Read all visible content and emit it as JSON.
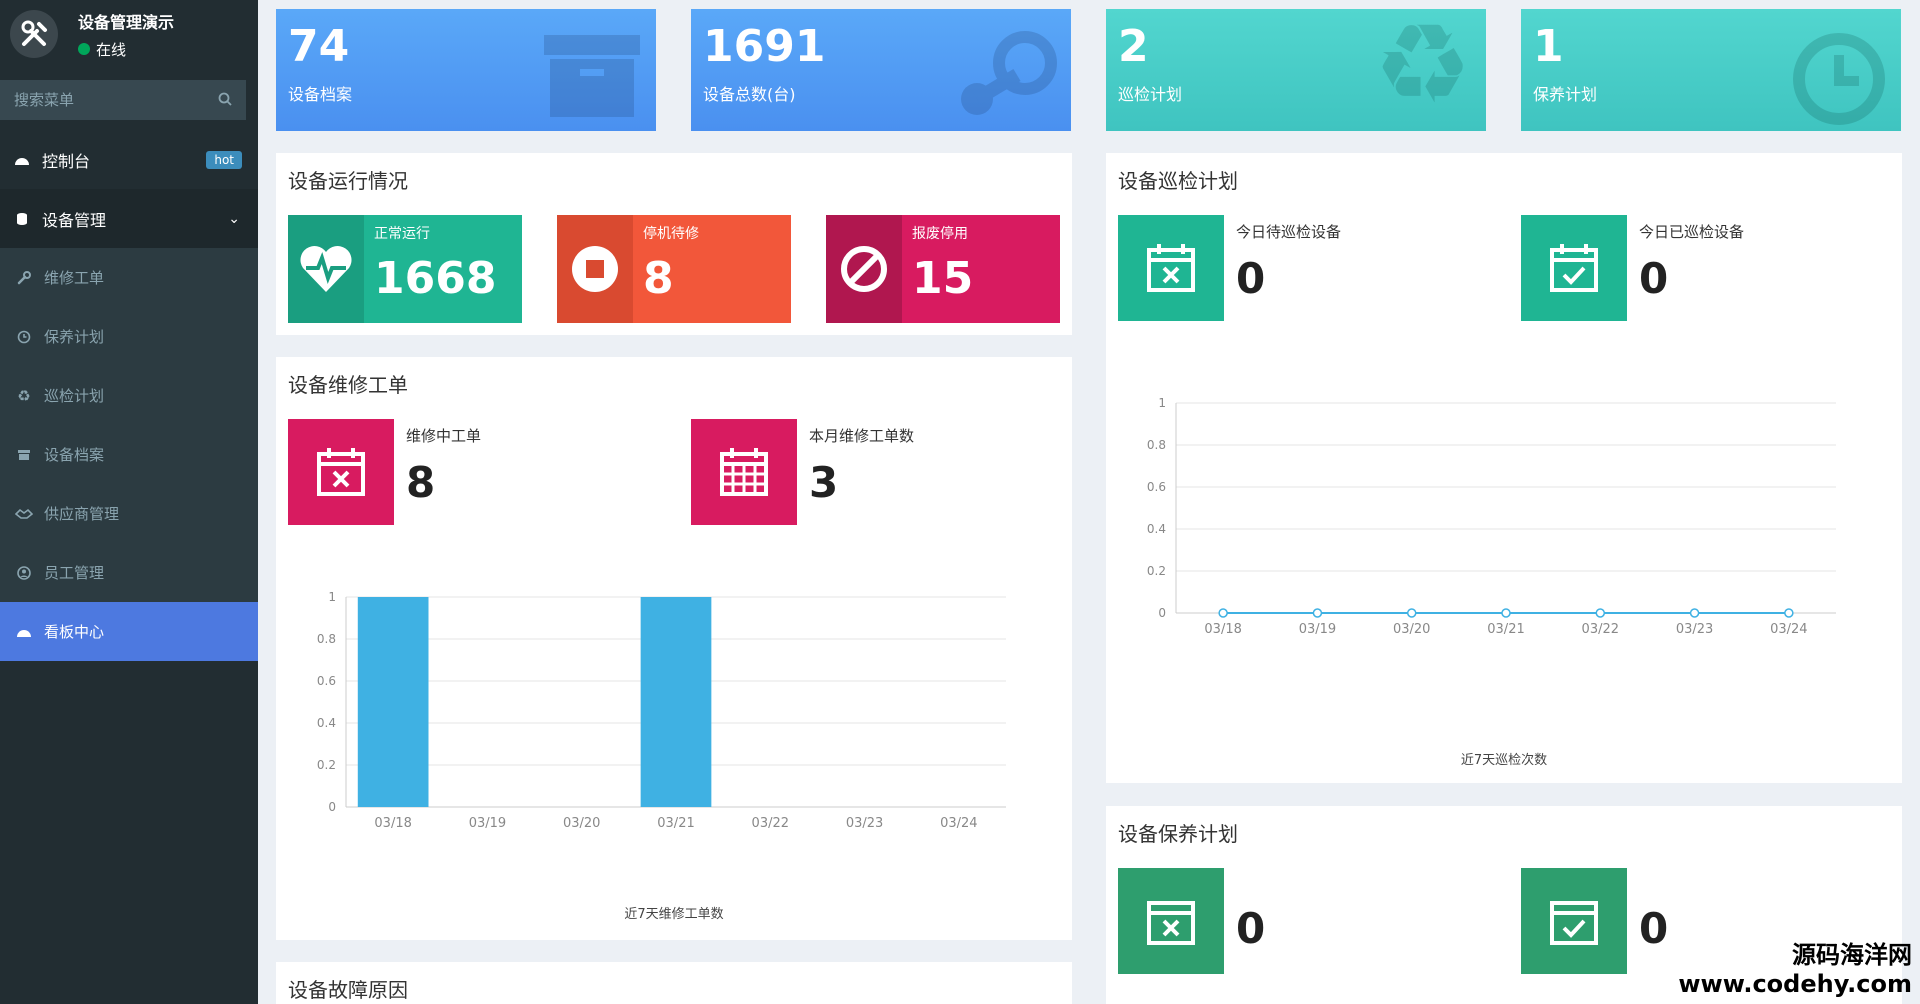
{
  "sidebar": {
    "brand_title": "设备管理演示",
    "status": "在线",
    "search_placeholder": "搜索菜单",
    "items": [
      {
        "label": "控制台",
        "badge": "hot"
      },
      {
        "label": "设备管理"
      },
      {
        "label": "维修工单"
      },
      {
        "label": "保养计划"
      },
      {
        "label": "巡检计划"
      },
      {
        "label": "设备档案"
      },
      {
        "label": "供应商管理"
      },
      {
        "label": "员工管理"
      },
      {
        "label": "看板中心"
      }
    ]
  },
  "stats": [
    {
      "value": "74",
      "label": "设备档案",
      "icon": "archive-icon"
    },
    {
      "value": "1691",
      "label": "设备总数(台)",
      "icon": "steam-icon"
    },
    {
      "value": "2",
      "label": "巡检计划",
      "icon": "recycle-icon"
    },
    {
      "value": "1",
      "label": "保养计划",
      "icon": "clock-icon"
    }
  ],
  "running": {
    "title": "设备运行情况",
    "tiles": [
      {
        "label": "正常运行",
        "value": "1668",
        "color": "#1fb593",
        "dark": "#1a9e80"
      },
      {
        "label": "停机待修",
        "value": "8",
        "color": "#f2573a",
        "dark": "#d94a30"
      },
      {
        "label": "报废停用",
        "value": "15",
        "color": "#d81b60",
        "dark": "#b0174f"
      }
    ]
  },
  "repair": {
    "title": "设备维修工单",
    "in_progress_label": "维修中工单",
    "in_progress_value": "8",
    "month_label": "本月维修工单数",
    "month_value": "3",
    "caption": "近7天维修工单数"
  },
  "inspection": {
    "title": "设备巡检计划",
    "pending_label": "今日待巡检设备",
    "pending_value": "0",
    "done_label": "今日已巡检设备",
    "done_value": "0",
    "caption": "近7天巡检次数"
  },
  "maintenance": {
    "title": "设备保养计划",
    "pending_value": "0",
    "done_value": "0"
  },
  "fault": {
    "title": "设备故障原因"
  },
  "watermark": {
    "line1": "源码海洋网",
    "line2": "www.codehy.com"
  },
  "chart_data": [
    {
      "type": "bar",
      "categories": [
        "03/18",
        "03/19",
        "03/20",
        "03/21",
        "03/22",
        "03/23",
        "03/24"
      ],
      "values": [
        1,
        0,
        0,
        1,
        0,
        0,
        0
      ],
      "title": "近7天维修工单数",
      "ylim": [
        0,
        1
      ],
      "yticks": [
        "0",
        "0.2",
        "0.4",
        "0.6",
        "0.8",
        "1"
      ],
      "color": "#3fb1e3"
    },
    {
      "type": "line",
      "categories": [
        "03/18",
        "03/19",
        "03/20",
        "03/21",
        "03/22",
        "03/23",
        "03/24"
      ],
      "values": [
        0,
        0,
        0,
        0,
        0,
        0,
        0
      ],
      "title": "近7天巡检次数",
      "ylim": [
        0,
        1
      ],
      "yticks": [
        "0",
        "0.2",
        "0.4",
        "0.6",
        "0.8",
        "1"
      ],
      "color": "#3fb1e3"
    }
  ]
}
